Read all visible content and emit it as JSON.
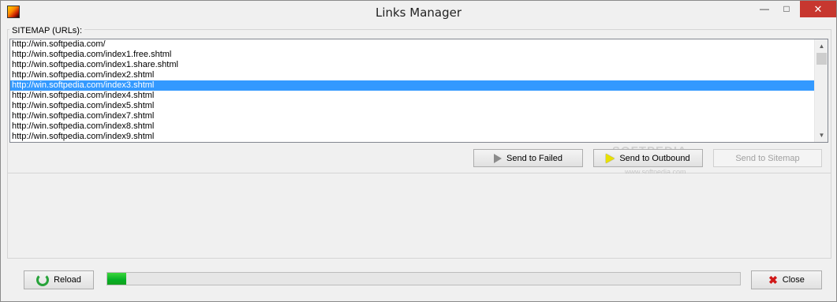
{
  "window": {
    "title": "Links Manager",
    "caption_buttons": {
      "minimize": "—",
      "maximize": "□",
      "close": "✕"
    }
  },
  "sitemap": {
    "label": "SITEMAP (URLs):",
    "selected_index": 4,
    "items": [
      "http://win.softpedia.com/",
      "http://win.softpedia.com/index1.free.shtml",
      "http://win.softpedia.com/index1.share.shtml",
      "http://win.softpedia.com/index2.shtml",
      "http://win.softpedia.com/index3.shtml",
      "http://win.softpedia.com/index4.shtml",
      "http://win.softpedia.com/index5.shtml",
      "http://win.softpedia.com/index7.shtml",
      "http://win.softpedia.com/index8.shtml",
      "http://win.softpedia.com/index9.shtml"
    ]
  },
  "actions": {
    "send_failed": "Send to Failed",
    "send_outbound": "Send to Outbound",
    "send_sitemap": "Send to Sitemap"
  },
  "watermark": {
    "brand": "SOFTPEDIA",
    "url": "www.softpedia.com"
  },
  "footer": {
    "reload": "Reload",
    "close": "Close",
    "progress_percent": 3
  },
  "colors": {
    "selection": "#3399ff",
    "progress": "#06b025",
    "close_caption": "#c7372f"
  }
}
